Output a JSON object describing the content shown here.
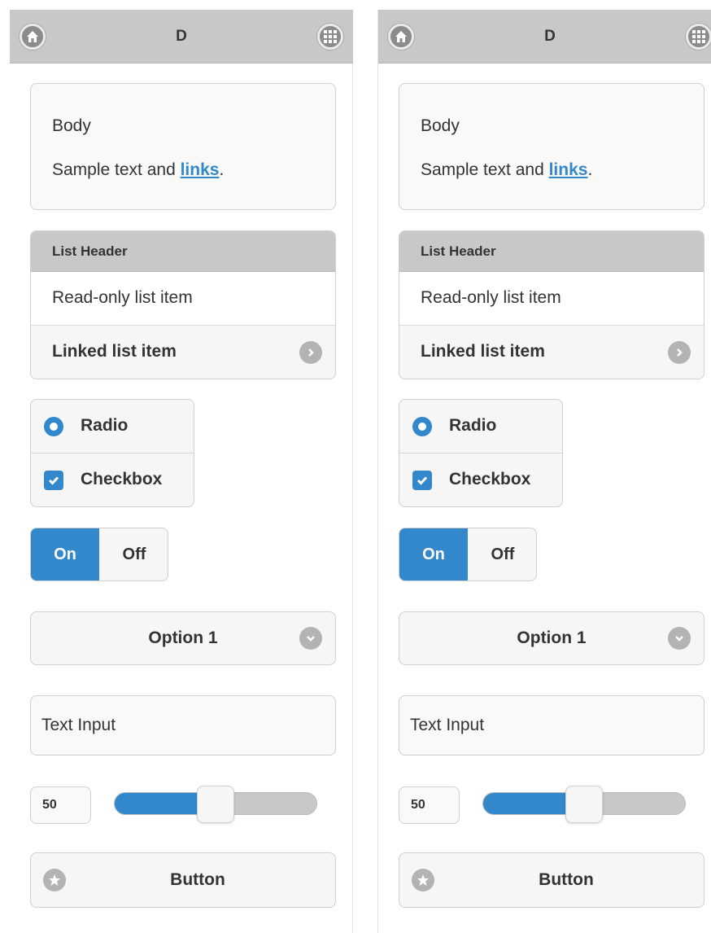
{
  "panels": [
    {
      "header": {
        "title": "D",
        "left_icon": "home-icon",
        "right_icon": "grid-icon"
      },
      "body": {
        "title": "Body",
        "text_prefix": "Sample text and ",
        "link": "links",
        "text_suffix": "."
      },
      "list": {
        "header": "List Header",
        "readonly_item": "Read-only list item",
        "linked_item": "Linked list item"
      },
      "choices": {
        "radio_label": "Radio",
        "checkbox_label": "Checkbox"
      },
      "flipswitch": {
        "on": "On",
        "off": "Off",
        "state": "on"
      },
      "select": {
        "value": "Option 1"
      },
      "text_input": {
        "placeholder": "Text Input",
        "value": ""
      },
      "slider": {
        "value": "50",
        "fraction": 0.5
      },
      "button": {
        "label": "Button",
        "icon": "star-icon"
      }
    },
    {
      "header": {
        "title": "D",
        "left_icon": "home-icon",
        "right_icon": "grid-icon"
      },
      "body": {
        "title": "Body",
        "text_prefix": "Sample text and ",
        "link": "links",
        "text_suffix": "."
      },
      "list": {
        "header": "List Header",
        "readonly_item": "Read-only list item",
        "linked_item": "Linked list item"
      },
      "choices": {
        "radio_label": "Radio",
        "checkbox_label": "Checkbox"
      },
      "flipswitch": {
        "on": "On",
        "off": "Off",
        "state": "on"
      },
      "select": {
        "value": "Option 1"
      },
      "text_input": {
        "placeholder": "Text Input",
        "value": ""
      },
      "slider": {
        "value": "50",
        "fraction": 0.5
      },
      "button": {
        "label": "Button",
        "icon": "star-icon"
      }
    }
  ],
  "colors": {
    "accent": "#3388cc",
    "header": "#c8c8c8",
    "icon_gray": "#b3b3b3"
  }
}
